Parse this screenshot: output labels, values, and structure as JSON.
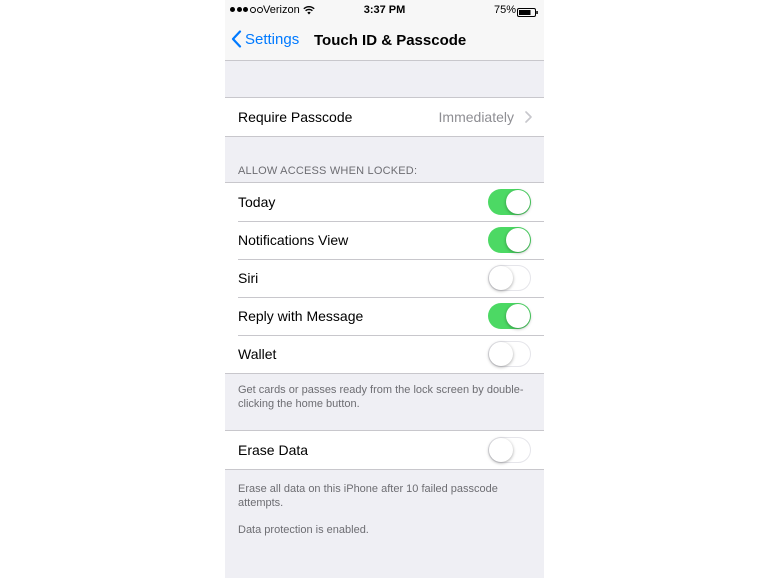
{
  "status_bar": {
    "carrier": "Verizon",
    "time": "3:37 PM",
    "battery": "75%"
  },
  "nav": {
    "back_label": "Settings",
    "title": "Touch ID & Passcode"
  },
  "require_passcode": {
    "label": "Require Passcode",
    "value": "Immediately"
  },
  "allow_access": {
    "header": "ALLOW ACCESS WHEN LOCKED:",
    "items": [
      {
        "label": "Today",
        "on": true
      },
      {
        "label": "Notifications View",
        "on": true
      },
      {
        "label": "Siri",
        "on": false
      },
      {
        "label": "Reply with Message",
        "on": true
      },
      {
        "label": "Wallet",
        "on": false
      }
    ],
    "footer": "Get cards or passes ready from the lock screen by double-clicking the home button."
  },
  "erase_data": {
    "label": "Erase Data",
    "on": false,
    "footer": "Erase all data on this iPhone after 10 failed passcode attempts.",
    "protection_note": "Data protection is enabled."
  },
  "colors": {
    "accent": "#007aff",
    "toggle_on": "#4cd964",
    "background": "#efeff4"
  }
}
